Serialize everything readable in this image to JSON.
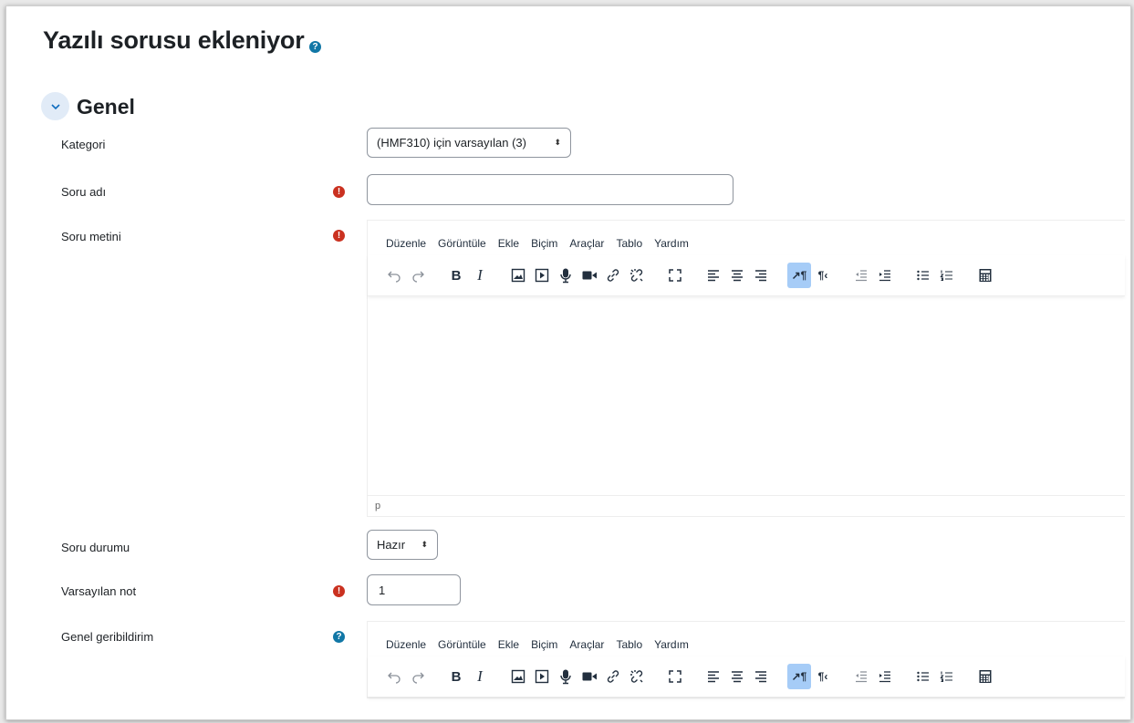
{
  "page": {
    "title": "Yazılı sorusu ekleniyor",
    "title_help_icon": "help-icon"
  },
  "section": {
    "title": "Genel",
    "toggle_icon": "chevron-down-icon"
  },
  "fields": {
    "category": {
      "label": "Kategori",
      "value": "(HMF310) için varsayılan (3)"
    },
    "question_name": {
      "label": "Soru adı",
      "value": "",
      "required_icon": "required-icon"
    },
    "question_text": {
      "label": "Soru metini",
      "required_icon": "required-icon"
    },
    "question_status": {
      "label": "Soru durumu",
      "value": "Hazır"
    },
    "default_mark": {
      "label": "Varsayılan not",
      "value": "1",
      "required_icon": "required-icon"
    },
    "general_feedback": {
      "label": "Genel geribildirim",
      "help_icon": "help-icon"
    }
  },
  "editor": {
    "menu": [
      "Düzenle",
      "Görüntüle",
      "Ekle",
      "Biçim",
      "Araçlar",
      "Tablo",
      "Yardım"
    ],
    "status_path": "p"
  },
  "colors": {
    "required": "#ca3120",
    "help": "#1177a6",
    "active_tool": "#a6ccf7",
    "toggle_bg": "#e1ebf7"
  }
}
